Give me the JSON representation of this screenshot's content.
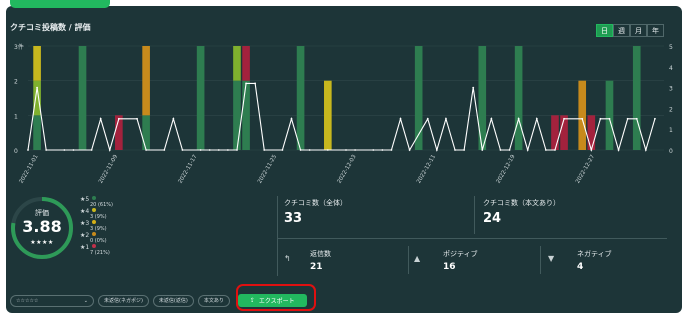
{
  "chart": {
    "title": "クチコミ投稿数 / 評価",
    "period_tabs": [
      "日",
      "週",
      "月",
      "年"
    ],
    "active_tab": "日",
    "left_axis_unit": "3件"
  },
  "chart_data": {
    "type": "bar",
    "x_labels": [
      "2022-11-01",
      "2022-11-09",
      "2022-11-17",
      "2022-11-25",
      "2022-12-03",
      "2022-12-11",
      "2022-12-19",
      "2022-12-27"
    ],
    "left_axis_ticks": [
      "3件",
      "2",
      "1",
      "0"
    ],
    "right_axis_ticks": [
      "5",
      "4",
      "3",
      "2",
      "1",
      "0"
    ],
    "ylim_count": [
      0,
      3
    ],
    "ylim_rating": [
      0,
      5
    ],
    "days": 61,
    "colors": {
      "5": "#2e7d50",
      "4": "#7fb02e",
      "3": "#c8b81e",
      "2": "#c78a1c",
      "1": "#a3223d",
      "line": "#ffffff"
    },
    "stacks": [
      {
        "day": 1,
        "s5": 1,
        "s4": 1,
        "s3": 1
      },
      {
        "day": 6,
        "s5": 3
      },
      {
        "day": 10,
        "s1": 1
      },
      {
        "day": 13,
        "s5": 1,
        "s2": 2
      },
      {
        "day": 19,
        "s5": 3
      },
      {
        "day": 23,
        "s5": 2,
        "s4": 1
      },
      {
        "day": 24,
        "s5": 2,
        "s1": 1
      },
      {
        "day": 30,
        "s5": 3
      },
      {
        "day": 33,
        "s3": 2
      },
      {
        "day": 43,
        "s5": 3
      },
      {
        "day": 50,
        "s5": 3
      },
      {
        "day": 54,
        "s5": 3
      },
      {
        "day": 58,
        "s1": 1
      },
      {
        "day": 59,
        "s1": 1
      },
      {
        "day": 61,
        "s2": 2
      },
      {
        "day": 62,
        "s1": 1
      },
      {
        "day": 64,
        "s5": 2
      },
      {
        "day": 67,
        "s5": 3
      }
    ],
    "rating_line": [
      [
        0,
        0
      ],
      [
        1,
        3
      ],
      [
        2,
        0
      ],
      [
        4,
        0
      ],
      [
        5,
        0
      ],
      [
        7,
        0
      ],
      [
        8,
        1.5
      ],
      [
        9,
        0
      ],
      [
        10,
        1.5
      ],
      [
        12,
        1.5
      ],
      [
        13,
        0
      ],
      [
        15,
        0
      ],
      [
        16,
        1.5
      ],
      [
        17,
        0
      ],
      [
        19,
        0
      ],
      [
        20,
        0
      ],
      [
        21,
        0
      ],
      [
        22,
        0
      ],
      [
        23,
        0
      ],
      [
        24,
        3.2
      ],
      [
        25,
        3.2
      ],
      [
        26,
        0
      ],
      [
        28,
        0
      ],
      [
        29,
        1.5
      ],
      [
        30,
        0
      ],
      [
        31,
        0
      ],
      [
        33,
        0
      ],
      [
        35,
        0
      ],
      [
        36,
        0
      ],
      [
        38,
        0
      ],
      [
        39,
        0
      ],
      [
        40,
        0
      ],
      [
        41,
        1.5
      ],
      [
        42,
        0
      ],
      [
        44,
        1.5
      ],
      [
        45,
        0
      ],
      [
        46,
        1.5
      ],
      [
        47,
        0
      ],
      [
        48,
        0
      ],
      [
        49,
        3
      ],
      [
        50,
        0
      ],
      [
        51,
        1.5
      ],
      [
        52,
        0
      ],
      [
        53,
        0
      ],
      [
        54,
        1.5
      ],
      [
        55,
        0
      ],
      [
        56,
        1.5
      ],
      [
        57,
        0
      ],
      [
        58,
        0
      ],
      [
        59,
        1.5
      ],
      [
        61,
        1.5
      ],
      [
        62,
        0
      ],
      [
        63,
        1.5
      ],
      [
        64,
        1.5
      ],
      [
        65,
        0
      ],
      [
        66,
        1.5
      ],
      [
        67,
        1.5
      ],
      [
        68,
        0
      ],
      [
        69,
        1.5
      ]
    ]
  },
  "rating": {
    "label": "評価",
    "value": "3.88",
    "stars": "★★★★",
    "gauge_fraction": 0.776,
    "distribution": [
      {
        "label": "★5",
        "count": "20",
        "pct": "(61%)",
        "color": "#2e7d50"
      },
      {
        "label": "★4",
        "count": "3",
        "pct": "(9%)",
        "color": "#c8b81e"
      },
      {
        "label": "★3",
        "count": "3",
        "pct": "(9%)",
        "color": "#d4b017"
      },
      {
        "label": "★2",
        "count": "0",
        "pct": "(0%)",
        "color": "#c78a1c"
      },
      {
        "label": "★1",
        "count": "7",
        "pct": "(21%)",
        "color": "#c0304a"
      }
    ]
  },
  "stats": {
    "total_label": "クチコミ数（全体）",
    "total_value": "33",
    "text_label": "クチコミ数（本文あり）",
    "text_value": "24",
    "replies_label": "返信数",
    "replies_value": "21",
    "positive_label": "ポジティブ",
    "positive_value": "16",
    "negative_label": "ネガティブ",
    "negative_value": "4"
  },
  "filters": {
    "stars_select": "☆☆☆☆☆",
    "unreplied_negative": "未返信(ネガポジ)",
    "unreplied_text": "未返信(返信)",
    "with_text": "本文あり",
    "export_label": "エクスポート"
  }
}
